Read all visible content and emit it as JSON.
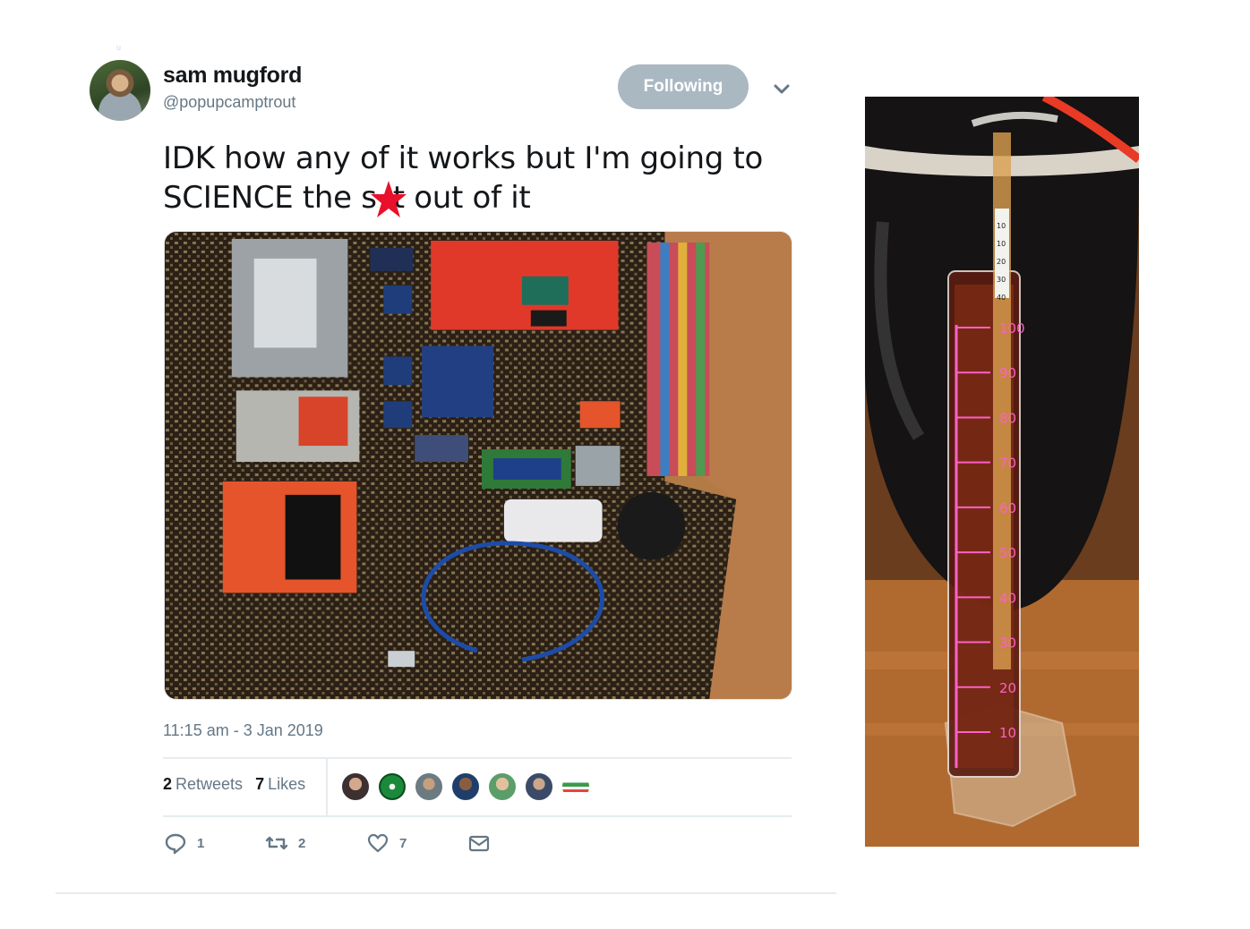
{
  "tweet": {
    "author": {
      "name": "sam mugford",
      "handle": "@popupcamptrout"
    },
    "follow_button": "Following",
    "text_line1": "IDK how any of it works but I'm going to",
    "text_line2_before": "SCIENCE the s",
    "text_line2_after": "t out of it",
    "timestamp": "11:15 am - 3 Jan 2019",
    "stats": {
      "retweets_count": "2",
      "retweets_label": "Retweets",
      "likes_count": "7",
      "likes_label": "Likes"
    },
    "actions": {
      "reply_count": "1",
      "retweet_count": "2",
      "like_count": "7"
    },
    "liker_avatars": 7
  },
  "cylinder_scale": [
    "10",
    "20",
    "30",
    "40",
    "50",
    "60",
    "70",
    "80",
    "90",
    "100"
  ],
  "hydrometer_scale": [
    "10",
    "10",
    "20",
    "30",
    "40"
  ],
  "colors": {
    "follow_button": "#aab8c2",
    "secondary_text": "#657786",
    "star": "#e8102a",
    "scale_text": "#ff5fc8"
  },
  "icons": [
    "chevron-down-icon",
    "reply-icon",
    "retweet-icon",
    "heart-icon",
    "envelope-icon",
    "star-icon"
  ]
}
